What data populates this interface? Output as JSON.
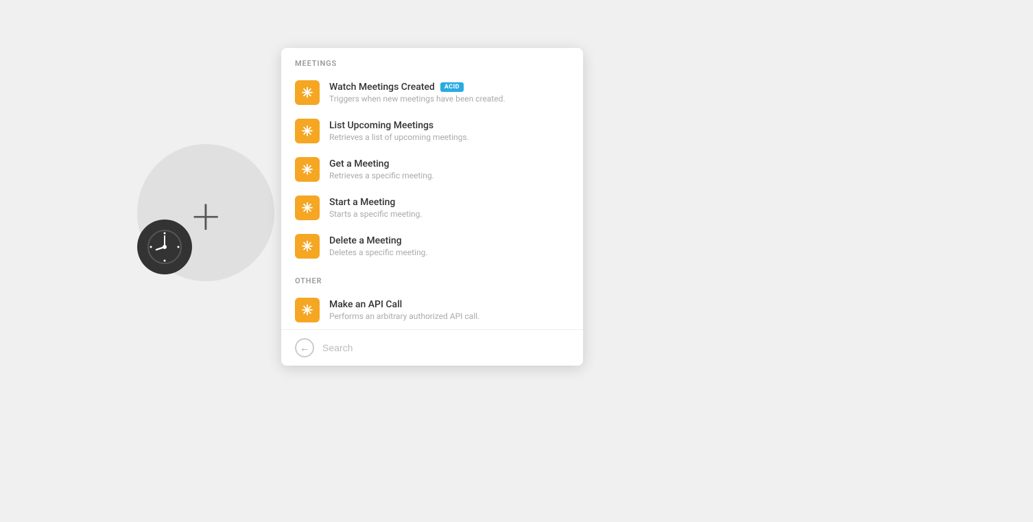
{
  "background": {
    "color": "#f0f0f0"
  },
  "sections": {
    "meetings": {
      "label": "MEETINGS",
      "items": [
        {
          "id": "watch-meetings",
          "title": "Watch Meetings Created",
          "badge": "ACID",
          "description": "Triggers when new meetings have been created.",
          "icon": "*"
        },
        {
          "id": "list-upcoming",
          "title": "List Upcoming Meetings",
          "badge": null,
          "description": "Retrieves a list of upcoming meetings.",
          "icon": "*"
        },
        {
          "id": "get-meeting",
          "title": "Get a Meeting",
          "badge": null,
          "description": "Retrieves a specific meeting.",
          "icon": "*"
        },
        {
          "id": "start-meeting",
          "title": "Start a Meeting",
          "badge": null,
          "description": "Starts a specific meeting.",
          "icon": "*"
        },
        {
          "id": "delete-meeting",
          "title": "Delete a Meeting",
          "badge": null,
          "description": "Deletes a specific meeting.",
          "icon": "*"
        }
      ]
    },
    "other": {
      "label": "OTHER",
      "items": [
        {
          "id": "api-call",
          "title": "Make an API Call",
          "badge": null,
          "description": "Performs an arbitrary authorized API call.",
          "icon": "*"
        }
      ]
    }
  },
  "search": {
    "placeholder": "Search",
    "back_arrow": "←"
  },
  "badge_color": "#29abe2",
  "icon_color": "#f5a623"
}
